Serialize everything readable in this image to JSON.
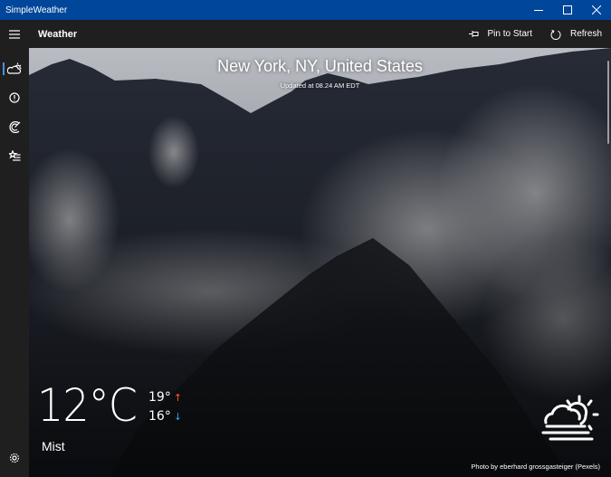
{
  "window": {
    "title": "SimpleWeather",
    "controls": {
      "minimize": "–",
      "maximize": "☐",
      "close": "✕"
    }
  },
  "commandbar": {
    "menu_icon": "hamburger-icon",
    "page_title": "Weather",
    "pin_label": "Pin to Start",
    "pin_icon": "pin-icon",
    "refresh_label": "Refresh",
    "refresh_icon": "refresh-icon"
  },
  "sidebar": {
    "items": [
      {
        "name": "weather",
        "icon": "partly-cloudy-icon",
        "selected": true
      },
      {
        "name": "alerts",
        "icon": "alert-icon",
        "selected": false
      },
      {
        "name": "radar",
        "icon": "radar-icon",
        "selected": false
      },
      {
        "name": "locations",
        "icon": "favorites-list-icon",
        "selected": false
      }
    ],
    "settings_icon": "gear-icon"
  },
  "weather": {
    "location": "New York, NY, United States",
    "updated": "Updated at 08.24 AM EDT",
    "temperature": "12°C",
    "high": "19°",
    "high_arrow": "↑",
    "low": "16°",
    "low_arrow": "↓",
    "condition": "Mist",
    "condition_icon": "sun-cloud-fog-icon",
    "photo_credit": "Photo by eberhard grossgasteiger (Pexels)"
  },
  "colors": {
    "titlebar": "#00469a",
    "chrome": "#1f1f1f",
    "high_arrow": "#ff5a1f",
    "low_arrow": "#2fa4e7",
    "selected_indicator": "#4a90d9"
  }
}
